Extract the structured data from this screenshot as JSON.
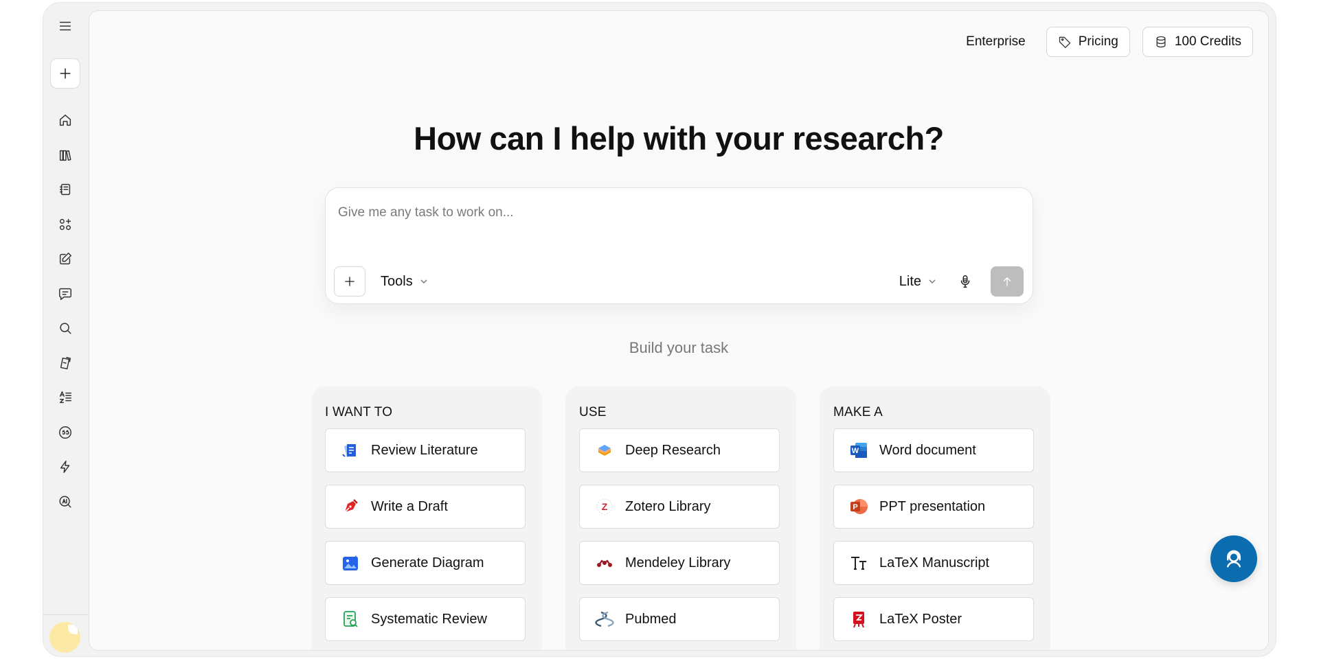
{
  "header": {
    "enterprise_label": "Enterprise",
    "pricing_label": "Pricing",
    "credits_label": "100 Credits"
  },
  "main": {
    "headline": "How can I help with your research?",
    "prompt": {
      "placeholder": "Give me any task to work on...",
      "value": "",
      "tools_label": "Tools",
      "mode_label": "Lite"
    },
    "build_label": "Build your task"
  },
  "sections": [
    {
      "title": "I WANT TO",
      "items": [
        {
          "label": "Review Literature",
          "icon": "review-literature-icon"
        },
        {
          "label": "Write a Draft",
          "icon": "pen-nib-icon"
        },
        {
          "label": "Generate Diagram",
          "icon": "image-sparkle-icon"
        },
        {
          "label": "Systematic Review",
          "icon": "document-search-icon"
        }
      ]
    },
    {
      "title": "USE",
      "items": [
        {
          "label": "Deep Research",
          "icon": "layers-icon"
        },
        {
          "label": "Zotero Library",
          "icon": "zotero-icon"
        },
        {
          "label": "Mendeley Library",
          "icon": "mendeley-icon"
        },
        {
          "label": "Pubmed",
          "icon": "pubmed-icon"
        }
      ]
    },
    {
      "title": "MAKE A",
      "items": [
        {
          "label": "Word document",
          "icon": "word-icon"
        },
        {
          "label": "PPT presentation",
          "icon": "powerpoint-icon"
        },
        {
          "label": "LaTeX Manuscript",
          "icon": "text-type-icon"
        },
        {
          "label": "LaTeX Poster",
          "icon": "poster-icon"
        }
      ]
    }
  ],
  "sidebar": {
    "icons": [
      "menu-icon",
      "plus-icon",
      "home-icon",
      "library-icon",
      "notebook-icon",
      "apps-icon",
      "edit-icon",
      "chat-icon",
      "search-icon",
      "cards-icon",
      "translate-icon",
      "citation-icon",
      "lightning-icon",
      "ai-detector-icon"
    ]
  },
  "colors": {
    "accent": "#0b6cb0",
    "send_disabled": "#bdbdbd",
    "word_blue": "#185abd",
    "ppt_orange": "#d24726",
    "latex_red": "#c8102e"
  }
}
